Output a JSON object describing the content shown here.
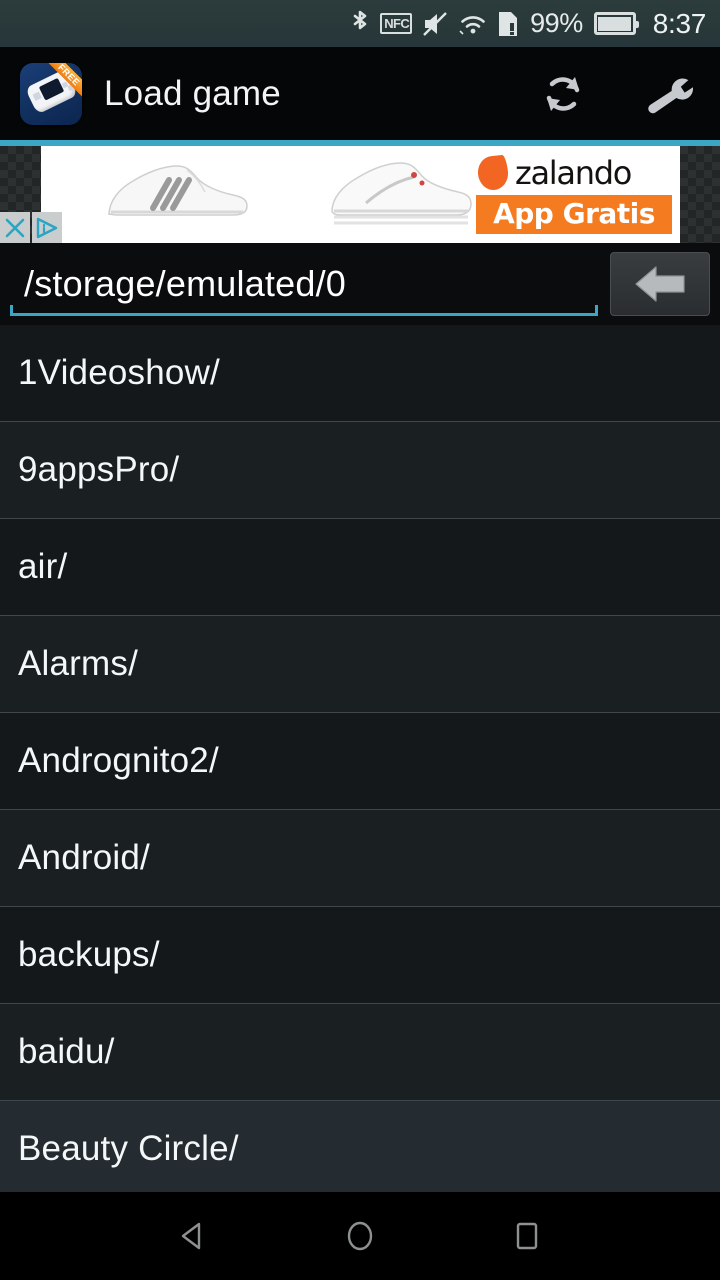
{
  "status_bar": {
    "icons": [
      "bluetooth-icon",
      "nfc-icon",
      "volume-muted-icon",
      "wifi-icon",
      "sim-alert-icon"
    ],
    "nfc_label": "NFC",
    "battery_percent": "99%",
    "time": "8:37"
  },
  "app_bar": {
    "icon_name": "gba-emulator-app-icon",
    "icon_badge": "FREE",
    "title": "Load game",
    "actions": [
      {
        "name": "refresh-button",
        "icon": "refresh-icon"
      },
      {
        "name": "settings-button",
        "icon": "wrench-icon"
      }
    ],
    "accent_color": "#3ba7c4"
  },
  "ad": {
    "advertiser": "zalando",
    "cta": "App Gratis",
    "close_label": "✕",
    "adchoices_label": "i",
    "brand_color": "#f47b20",
    "images": [
      "white-sneaker-adidas",
      "white-sneaker-reebok"
    ]
  },
  "path_bar": {
    "value": "/storage/emulated/0",
    "placeholder": "/storage/emulated/0",
    "back_button_name": "navigate-up-button",
    "underline_color": "#3ba7c4"
  },
  "file_list": {
    "items": [
      {
        "name": "1Videoshow/",
        "selected": false
      },
      {
        "name": "9appsPro/",
        "selected": false
      },
      {
        "name": "air/",
        "selected": false
      },
      {
        "name": "Alarms/",
        "selected": false
      },
      {
        "name": "Andrognito2/",
        "selected": false
      },
      {
        "name": "Android/",
        "selected": false
      },
      {
        "name": "backups/",
        "selected": false
      },
      {
        "name": "baidu/",
        "selected": false
      },
      {
        "name": "Beauty Circle/",
        "selected": true
      }
    ]
  },
  "nav_bar": {
    "buttons": [
      {
        "name": "android-back-button",
        "icon": "triangle-left-icon"
      },
      {
        "name": "android-home-button",
        "icon": "circle-icon"
      },
      {
        "name": "android-recents-button",
        "icon": "square-icon"
      }
    ]
  }
}
